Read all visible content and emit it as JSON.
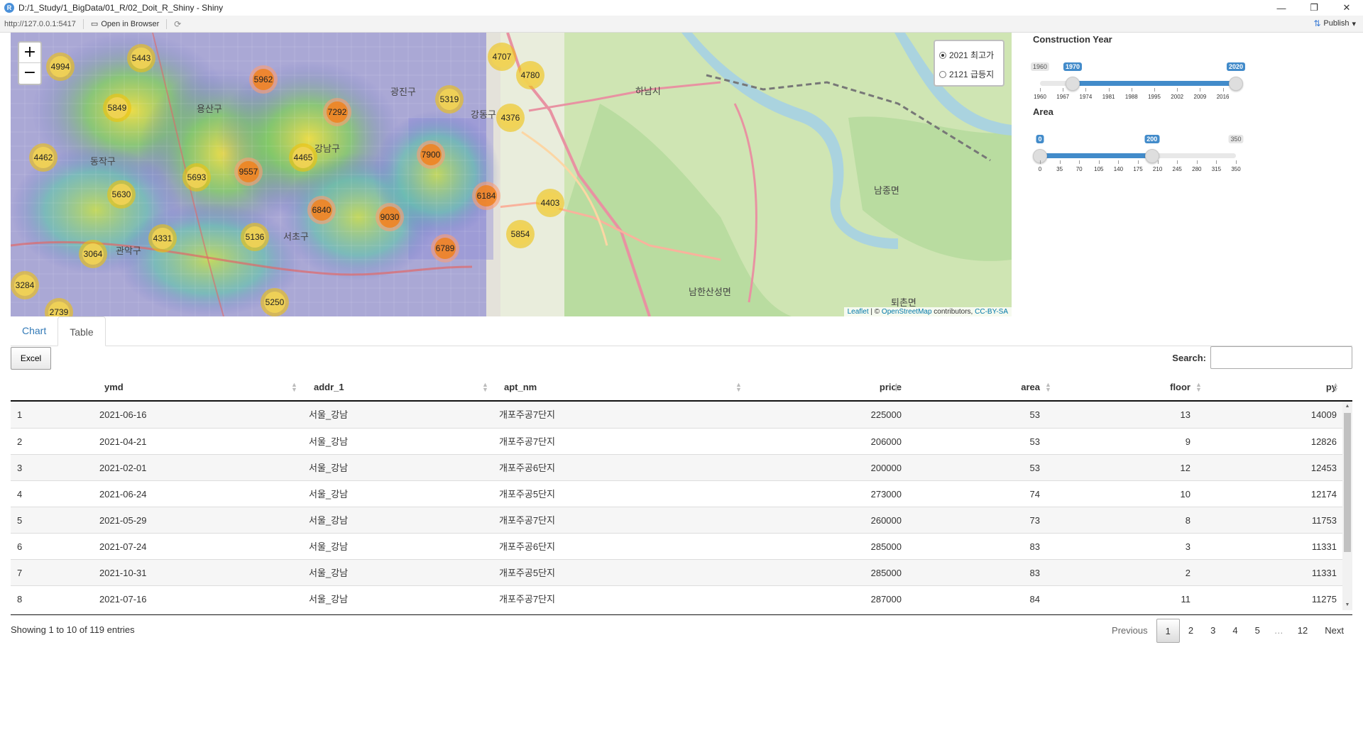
{
  "window": {
    "title": "D:/1_Study/1_BigData/01_R/02_Doit_R_Shiny - Shiny",
    "logo": "R"
  },
  "toolbar": {
    "url": "http://127.0.0.1:5417",
    "open_browser": "Open in Browser",
    "publish": "Publish"
  },
  "map": {
    "zoom_in": "+",
    "zoom_out": "−",
    "layers": [
      {
        "label": "2021 최고가",
        "checked": true
      },
      {
        "label": "2121 급등지",
        "checked": false
      }
    ],
    "attribution": {
      "leaflet": "Leaflet",
      "sep": " | © ",
      "osm": "OpenStreetMap",
      "contrib": " contributors, ",
      "license": "CC-BY-SA"
    },
    "clusters": [
      "5443",
      "4994",
      "4707",
      "4780",
      "5962",
      "5319",
      "5849",
      "7292",
      "4376",
      "4462",
      "4465",
      "7900",
      "9557",
      "5693",
      "6184",
      "5630",
      "6840",
      "9030",
      "4403",
      "4331",
      "5136",
      "5854",
      "3064",
      "6789",
      "3284",
      "5250",
      "2739"
    ],
    "places": [
      "용산구",
      "동작구",
      "강남구",
      "서초구",
      "관악구",
      "강동구",
      "하남시",
      "남한산성면",
      "남종면",
      "퇴촌면",
      "광진구",
      "관악구"
    ]
  },
  "sliders": {
    "construction_year": {
      "title": "Construction Year",
      "min": 1960,
      "max": 2020,
      "from": 1970,
      "to": 2020,
      "min_label": "1960",
      "max_label": "2020",
      "from_label": "1970",
      "to_label": "2020",
      "ticks": [
        "1960",
        "1967",
        "1974",
        "1981",
        "1988",
        "1995",
        "2002",
        "2009",
        "2016"
      ]
    },
    "area": {
      "title": "Area",
      "min": 0,
      "max": 350,
      "from": 0,
      "to": 200,
      "min_label": "0",
      "max_label": "350",
      "from_label": "0",
      "to_label": "200",
      "ticks": [
        "0",
        "35",
        "70",
        "105",
        "140",
        "175",
        "210",
        "245",
        "280",
        "315",
        "350"
      ]
    }
  },
  "tabs": [
    {
      "label": "Chart",
      "active": false
    },
    {
      "label": "Table",
      "active": true
    }
  ],
  "table": {
    "excel_label": "Excel",
    "search_label": "Search:",
    "search_value": "",
    "columns": [
      "",
      "ymd",
      "addr_1",
      "apt_nm",
      "price",
      "area",
      "floor",
      "py"
    ],
    "rows": [
      [
        "1",
        "2021-06-16",
        "서울_강남",
        "개포주공7단지",
        "225000",
        "53",
        "13",
        "14009"
      ],
      [
        "2",
        "2021-04-21",
        "서울_강남",
        "개포주공7단지",
        "206000",
        "53",
        "9",
        "12826"
      ],
      [
        "3",
        "2021-02-01",
        "서울_강남",
        "개포주공6단지",
        "200000",
        "53",
        "12",
        "12453"
      ],
      [
        "4",
        "2021-06-24",
        "서울_강남",
        "개포주공5단지",
        "273000",
        "74",
        "10",
        "12174"
      ],
      [
        "5",
        "2021-05-29",
        "서울_강남",
        "개포주공7단지",
        "260000",
        "73",
        "8",
        "11753"
      ],
      [
        "6",
        "2021-07-24",
        "서울_강남",
        "개포주공6단지",
        "285000",
        "83",
        "3",
        "11331"
      ],
      [
        "7",
        "2021-10-31",
        "서울_강남",
        "개포주공5단지",
        "285000",
        "83",
        "2",
        "11331"
      ],
      [
        "8",
        "2021-07-16",
        "서울_강남",
        "개포주공7단지",
        "287000",
        "84",
        "11",
        "11275"
      ]
    ],
    "info": "Showing 1 to 10 of 119 entries",
    "pager": {
      "previous": "Previous",
      "pages": [
        "1",
        "2",
        "3",
        "4",
        "5"
      ],
      "ellipsis": "…",
      "last": "12",
      "next": "Next",
      "current": "1"
    }
  },
  "colors": {
    "accent": "#428bca",
    "link": "#337ab7",
    "cluster_yellow": "#f1d357",
    "cluster_orange": "#f18017"
  }
}
